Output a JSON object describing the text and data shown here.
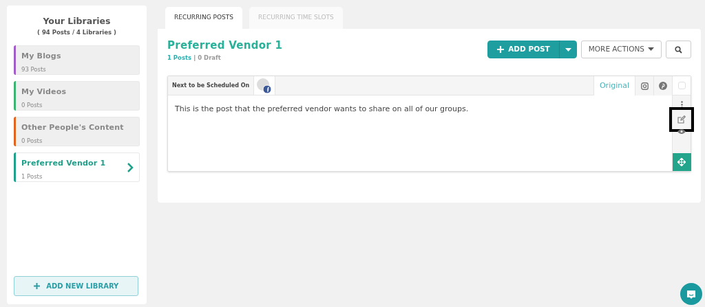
{
  "sidebar": {
    "title": "Your Libraries",
    "summary": "( 94 Posts / 4 Libraries )",
    "libraries": [
      {
        "name": "My Blogs",
        "count": "93 Posts",
        "color": "#a05cc8",
        "selected": false
      },
      {
        "name": "My Videos",
        "count": "0 Posts",
        "color": "#3cb371",
        "selected": false
      },
      {
        "name": "Other People's Content",
        "count": "0 Posts",
        "color": "#e0641e",
        "selected": false
      },
      {
        "name": "Preferred Vendor 1",
        "count": "1 Posts",
        "color": "#1fa08a",
        "selected": true
      }
    ],
    "add_button": "ADD NEW LIBRARY"
  },
  "tabs": [
    {
      "label": "RECURRING POSTS",
      "selected": true
    },
    {
      "label": "RECURRING TIME SLOTS",
      "selected": false
    }
  ],
  "library": {
    "title": "Preferred Vendor 1",
    "posts": "1 Posts",
    "separator": "|",
    "drafts": "0 Draft"
  },
  "toolbar": {
    "add_post": "ADD POST",
    "more_actions": "MORE ACTIONS"
  },
  "post": {
    "schedule_label": "Next to be Scheduled On",
    "variants": [
      {
        "kind": "text",
        "label": "Original",
        "selected": true
      },
      {
        "kind": "instagram",
        "selected": false
      },
      {
        "kind": "pinterest",
        "selected": false
      }
    ],
    "checked": false,
    "text": "This is the post that the preferred vendor wants to share on all of our groups.",
    "edit_highlighted": true
  }
}
